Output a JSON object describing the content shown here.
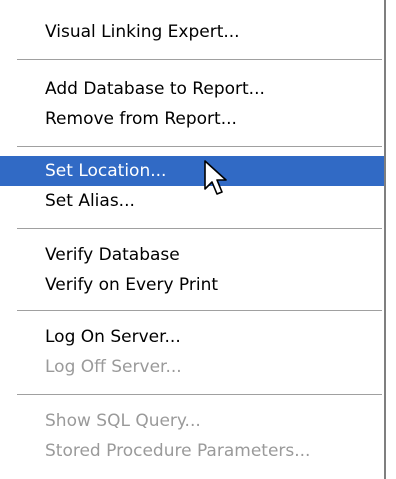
{
  "menu": {
    "items": [
      {
        "label": "Visual Linking Expert...",
        "enabled": true
      },
      {
        "label": "Add Database to Report...",
        "enabled": true
      },
      {
        "label": "Remove from Report...",
        "enabled": true
      },
      {
        "label": "Set Location...",
        "enabled": true,
        "selected": true
      },
      {
        "label": "Set Alias...",
        "enabled": true
      },
      {
        "label": "Verify Database",
        "enabled": true
      },
      {
        "label": "Verify on Every Print",
        "enabled": true
      },
      {
        "label": "Log On Server...",
        "enabled": true
      },
      {
        "label": "Log Off Server...",
        "enabled": false
      },
      {
        "label": "Show SQL Query...",
        "enabled": false
      },
      {
        "label": "Stored Procedure Parameters...",
        "enabled": false
      }
    ]
  },
  "colors": {
    "highlight": "#316ac5",
    "disabled_text": "#9a9a9a",
    "separator": "#a0a0a0"
  },
  "cursor": {
    "icon": "arrow-cursor-icon"
  }
}
